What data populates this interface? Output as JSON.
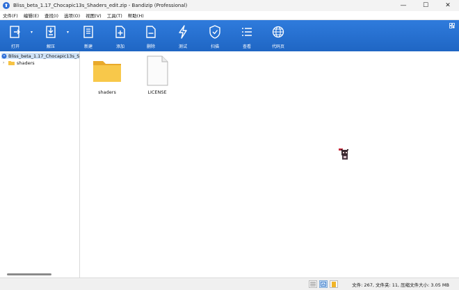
{
  "window": {
    "title": "Bliss_beta_1.17_Chocapic13s_Shaders_edit.zip - Bandizip (Professional)",
    "controls": {
      "minimize": "—",
      "maximize": "☐",
      "close": "✕"
    }
  },
  "menu": {
    "items": [
      "文件(F)",
      "编辑(E)",
      "查找(I)",
      "选项(O)",
      "视图(V)",
      "工具(T)",
      "帮助(H)"
    ]
  },
  "toolbar": {
    "buttons": [
      {
        "label": "打开",
        "icon": "open-icon"
      },
      {
        "label": "解压",
        "icon": "extract-icon"
      },
      {
        "label": "新建",
        "icon": "new-archive-icon"
      },
      {
        "label": "添加",
        "icon": "add-file-icon"
      },
      {
        "label": "删除",
        "icon": "delete-file-icon"
      },
      {
        "label": "测试",
        "icon": "test-bolt-icon"
      },
      {
        "label": "扫描",
        "icon": "scan-shield-icon"
      },
      {
        "label": "查看",
        "icon": "view-list-icon"
      },
      {
        "label": "代码页",
        "icon": "codepage-globe-icon"
      }
    ],
    "accent": "#2f7bdc"
  },
  "tree": {
    "root_label": "Bliss_beta_1.17_Chocapic13s_S",
    "children": [
      {
        "toggle": "›",
        "label": "shaders"
      }
    ]
  },
  "files": [
    {
      "name": "shaders",
      "type": "folder"
    },
    {
      "name": "LICENSE",
      "type": "file"
    }
  ],
  "status": {
    "text": "文件: 267, 文件夹: 11, 压缩文件大小: 3.05 MB"
  }
}
